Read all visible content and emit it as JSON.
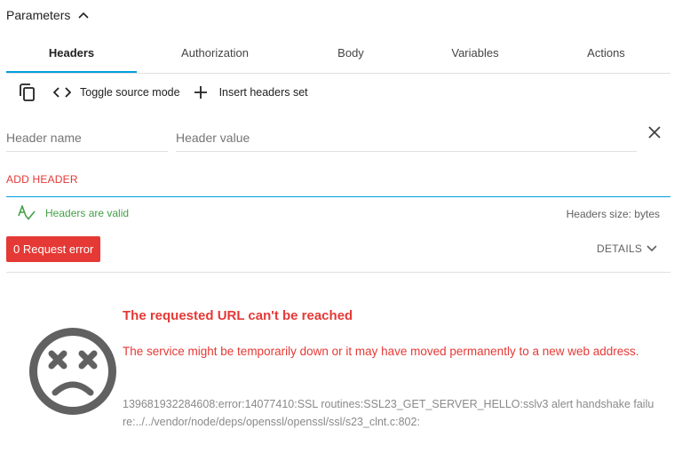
{
  "params": {
    "title": "Parameters"
  },
  "tabs": [
    {
      "label": "Headers"
    },
    {
      "label": "Authorization"
    },
    {
      "label": "Body"
    },
    {
      "label": "Variables"
    },
    {
      "label": "Actions"
    }
  ],
  "active_tab": "Headers",
  "toolbar": {
    "toggle_label": "Toggle source mode",
    "insert_label": "Insert headers set"
  },
  "header_form": {
    "name_placeholder": "Header name",
    "name_value": "",
    "value_placeholder": "Header value",
    "value_value": ""
  },
  "add_header_label": "ADD HEADER",
  "validation": {
    "text": "Headers are valid",
    "color": "#43a047"
  },
  "size": {
    "text": "Headers size: bytes"
  },
  "request_error": {
    "label": "0 Request error",
    "color": "#e53935"
  },
  "details_label": "DETAILS",
  "error": {
    "icon": "sad-face-icon",
    "title": "The requested URL can't be reached",
    "message": "The service might be temporarily down or it may have moved permanently to a new web address.",
    "detail": "139681932284608:error:14077410:SSL routines:SSL23_GET_SERVER_HELLO:sslv3 alert handshake failure:../../vendor/node/deps/openssl/openssl/ssl/s23_clnt.c:802:"
  },
  "colors": {
    "accent": "#00a1df",
    "error": "#e53935",
    "success": "#43a047"
  }
}
